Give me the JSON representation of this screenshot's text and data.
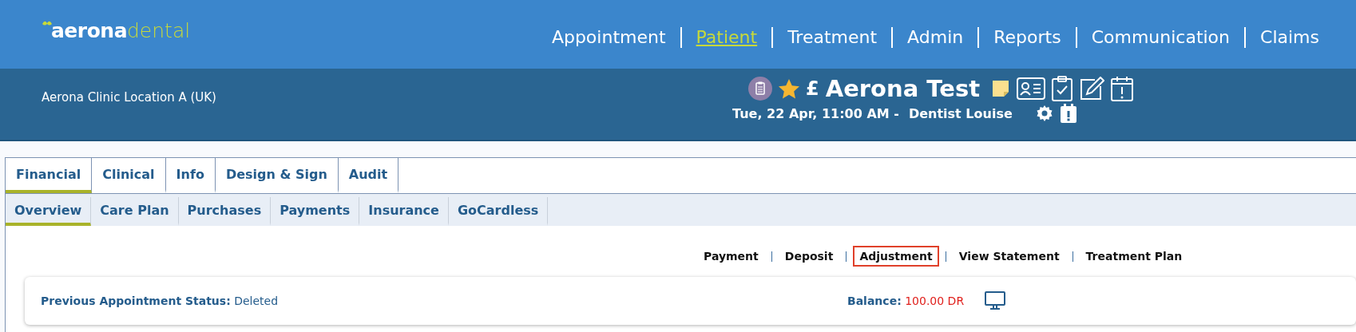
{
  "logo": {
    "part_1": "aerona",
    "part_2": "dental"
  },
  "nav": [
    {
      "label": "Appointment",
      "selected": false
    },
    {
      "label": "Patient",
      "selected": true
    },
    {
      "label": "Treatment",
      "selected": false
    },
    {
      "label": "Admin",
      "selected": false
    },
    {
      "label": "Reports",
      "selected": false
    },
    {
      "label": "Communication",
      "selected": false
    },
    {
      "label": "Claims",
      "selected": false
    }
  ],
  "location": "Aerona Clinic Location A (UK)",
  "patient": {
    "currency": "£",
    "name": "Aerona Test",
    "appointment": "Tue, 22 Apr, 11:00 AM -",
    "dentist": "Dentist Louise"
  },
  "tabs": [
    {
      "label": "Financial",
      "selected": true
    },
    {
      "label": "Clinical",
      "selected": false
    },
    {
      "label": "Info",
      "selected": false
    },
    {
      "label": "Design & Sign",
      "selected": false
    },
    {
      "label": "Audit",
      "selected": false
    }
  ],
  "subtabs": [
    {
      "label": "Overview",
      "selected": true
    },
    {
      "label": "Care Plan",
      "selected": false
    },
    {
      "label": "Purchases",
      "selected": false
    },
    {
      "label": "Payments",
      "selected": false
    },
    {
      "label": "Insurance",
      "selected": false
    },
    {
      "label": "GoCardless",
      "selected": false
    }
  ],
  "actions": [
    {
      "label": "Payment",
      "highlighted": false
    },
    {
      "label": "Deposit",
      "highlighted": false
    },
    {
      "label": "Adjustment",
      "highlighted": true
    },
    {
      "label": "View Statement",
      "highlighted": false
    },
    {
      "label": "Treatment Plan",
      "highlighted": false
    }
  ],
  "status": {
    "label": "Previous Appointment Status:",
    "value": "Deleted"
  },
  "balance": {
    "label": "Balance:",
    "value": "100.00 DR"
  }
}
